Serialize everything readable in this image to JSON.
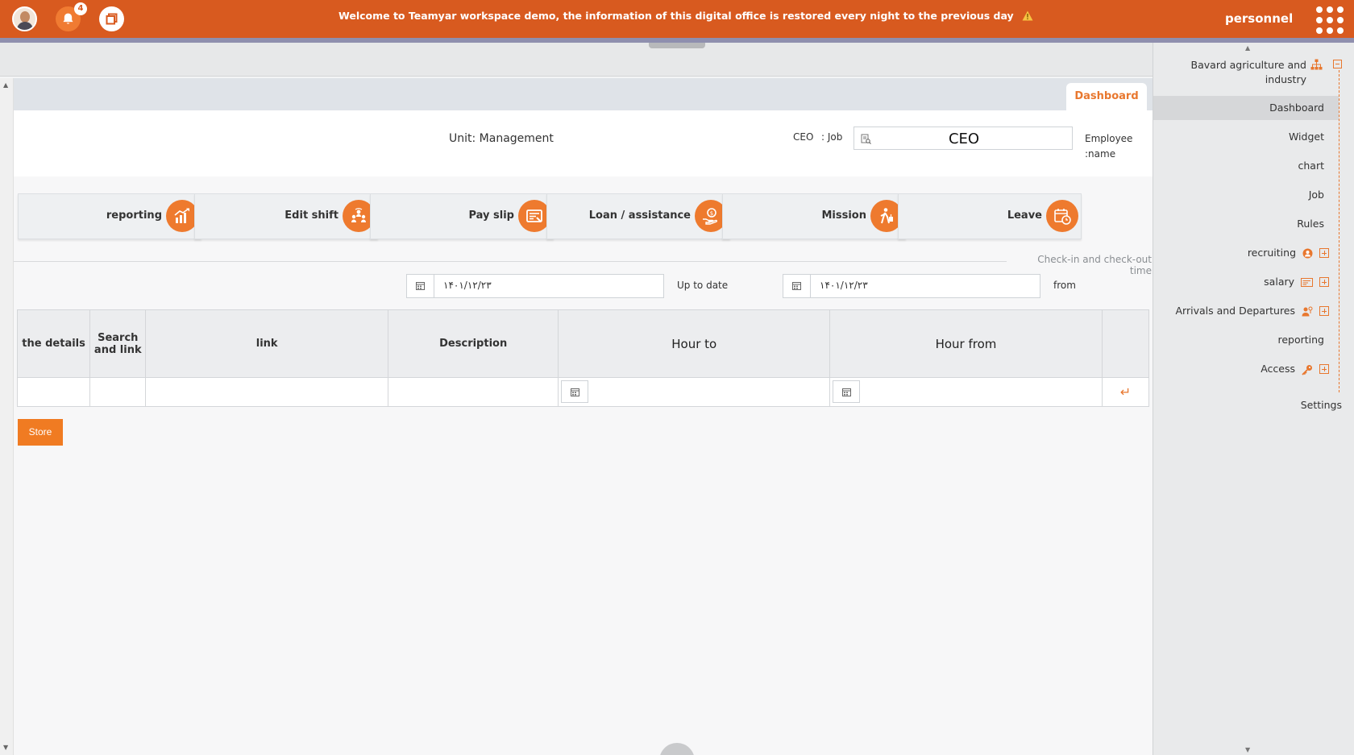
{
  "topbar": {
    "notification_count": "4",
    "welcome": "Welcome to Teamyar workspace demo, the information of this digital office is restored every night to the previous day",
    "app_title": "personnel"
  },
  "tabs": {
    "active": "Dashboard"
  },
  "info": {
    "unit": "Unit: Management",
    "job_value": "CEO",
    "job_label": ": Job",
    "employee_value": "CEO",
    "employee_label_1": "Employee",
    "employee_label_2": ":name"
  },
  "cards": [
    {
      "label": "reporting",
      "icon": "chart-growth-icon"
    },
    {
      "label": "Edit shift",
      "icon": "people-rotate-icon"
    },
    {
      "label": "Pay slip",
      "icon": "payslip-icon"
    },
    {
      "label": "Loan / assistance",
      "icon": "hand-coin-icon"
    },
    {
      "label": "Mission",
      "icon": "traveler-icon"
    },
    {
      "label": "Leave",
      "icon": "calendar-clock-icon"
    }
  ],
  "section": {
    "title": "Check-in and check-out time"
  },
  "filters": {
    "to_date": "۱۴۰۱/۱۲/۲۳",
    "to_label": "Up to date",
    "from_date": "۱۴۰۱/۱۲/۲۳",
    "from_label": "from"
  },
  "table": {
    "headers": [
      "the details",
      "Search and link",
      "link",
      "Description",
      "Hour to",
      "Hour from"
    ]
  },
  "store_label": "Store",
  "sidebar": {
    "org_line1": "Bavard agriculture and",
    "org_line2": "industry",
    "items": {
      "dashboard": "Dashboard",
      "widget": "Widget",
      "chart": "chart",
      "job": "Job",
      "rules": "Rules",
      "recruiting": "recruiting",
      "salary": "salary",
      "arrivals": "Arrivals and Departures",
      "reporting": "reporting",
      "access": "Access"
    },
    "settings": "Settings"
  },
  "colors": {
    "brand": "#d85a1f",
    "accent": "#ee7a2e"
  }
}
